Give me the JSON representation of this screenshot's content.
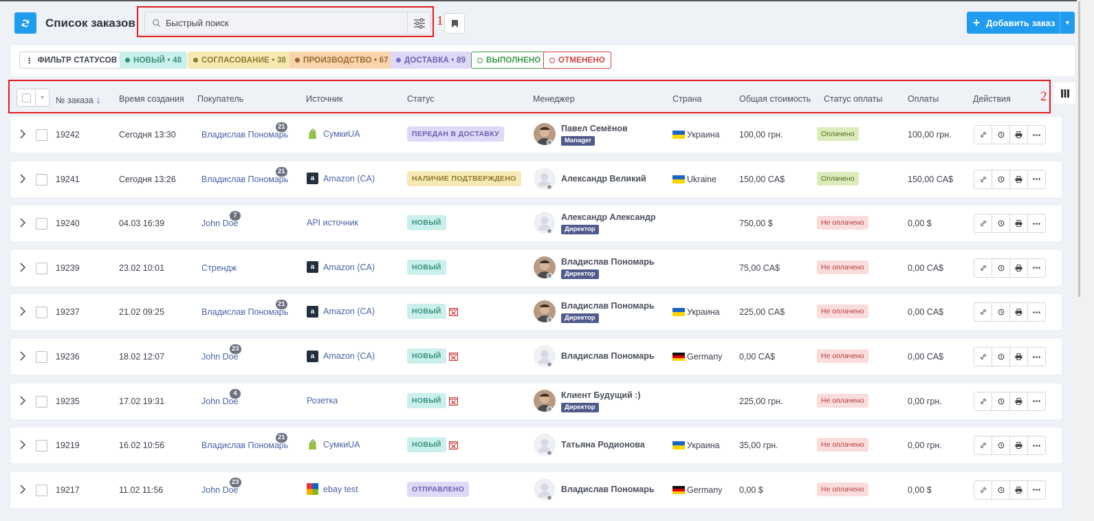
{
  "header": {
    "title": "Список заказов",
    "search_placeholder": "Быстрый поиск",
    "add_button": "Добавить заказ",
    "annotation_1": "1",
    "annotation_2": "2"
  },
  "status_filter": {
    "label": "ФИЛЬТР СТАТУСОВ",
    "chips": [
      {
        "label": "НОВЫЙ • 48",
        "bg": "#c9f0ea",
        "fg": "#3c8f82",
        "dot": "#2f8e7b"
      },
      {
        "label": "СОГЛАСОВАНИЕ • 38",
        "bg": "#f6eab4",
        "fg": "#8d7a2e",
        "dot": "#8d7a2e"
      },
      {
        "label": "ПРОИЗВОДСТВО • 67",
        "bg": "#f8d5ac",
        "fg": "#9b6533",
        "dot": "#9b6533"
      },
      {
        "label": "ДОСТАВКА • 89",
        "bg": "#ddd9f7",
        "fg": "#6b62b3",
        "dot": "#7b6fd1"
      },
      {
        "label": "ВЫПОЛНЕНО",
        "bg": "#fff",
        "fg": "#3b9a48",
        "dot": "#3b9a48",
        "outlined": true
      },
      {
        "label": "ОТМЕНЕНО",
        "bg": "#fff",
        "fg": "#d24040",
        "dot": "#d24040",
        "outlined": true
      }
    ]
  },
  "columns": {
    "order_no": "№ заказа",
    "created": "Время создания",
    "buyer": "Покупатель",
    "source": "Источник",
    "status": "Статус",
    "manager": "Менеджер",
    "country": "Страна",
    "total": "Общая стоимость",
    "payment_status": "Статус оплаты",
    "payments": "Оплаты",
    "actions": "Действия"
  },
  "rows": [
    {
      "id": "19242",
      "created": "Сегодня 13:30",
      "buyer": "Владислав Пономарь",
      "buyer_count": "21",
      "source": "СумкиUA",
      "source_icon": "shopify-icon",
      "status": "ПЕРЕДАН В ДОСТАВКУ",
      "status_style": "delivery",
      "cancel_icon": false,
      "manager": "Павел Семёнов",
      "role": "Manager",
      "avatar": "photo-icon",
      "country": "Украина",
      "flag": "ua",
      "total": "100,00 грн.",
      "pay": "Оплачено",
      "paid": true,
      "payments": "100,00 грн."
    },
    {
      "id": "19241",
      "created": "Сегодня 13:26",
      "buyer": "Владислав Пономарь",
      "buyer_count": "21",
      "source": "Amazon (CA)",
      "source_icon": "amazon-icon",
      "status": "НАЛИЧИЕ ПОДТВЕРЖДЕНО",
      "status_style": "confirmed",
      "cancel_icon": false,
      "manager": "Александр Великий",
      "role": "",
      "avatar": "placeholder",
      "country": "Ukraine",
      "flag": "ua",
      "total": "150,00 CA$",
      "pay": "Оплачено",
      "paid": true,
      "payments": "150,00 CA$"
    },
    {
      "id": "19240",
      "created": "04.03 16:39",
      "buyer": "John Doe",
      "buyer_count": "7",
      "source": "API источник",
      "source_icon": "",
      "status": "НОВЫЙ",
      "status_style": "new",
      "cancel_icon": false,
      "manager": "Александр Александр",
      "role": "Директор",
      "avatar": "placeholder",
      "country": "",
      "flag": "",
      "total": "750,00 $",
      "pay": "Не оплачено",
      "paid": false,
      "payments": "0,00 $"
    },
    {
      "id": "19239",
      "created": "23.02 10:01",
      "buyer": "Стрендж",
      "buyer_count": "",
      "source": "Amazon (CA)",
      "source_icon": "amazon-icon",
      "status": "НОВЫЙ",
      "status_style": "new",
      "cancel_icon": false,
      "manager": "Владислав Пономарь",
      "role": "Директор",
      "avatar": "photo-icon",
      "country": "",
      "flag": "",
      "total": "75,00 CA$",
      "pay": "Не оплачено",
      "paid": false,
      "payments": "0,00 CA$"
    },
    {
      "id": "19237",
      "created": "21.02 09:25",
      "buyer": "Владислав Пономарь",
      "buyer_count": "21",
      "source": "Amazon (CA)",
      "source_icon": "amazon-icon",
      "status": "НОВЫЙ",
      "status_style": "new",
      "cancel_icon": true,
      "manager": "Владислав Пономарь",
      "role": "Директор",
      "avatar": "photo-icon",
      "country": "Украина",
      "flag": "ua",
      "total": "225,00 CA$",
      "pay": "Не оплачено",
      "paid": false,
      "payments": "0,00 CA$"
    },
    {
      "id": "19236",
      "created": "18.02 12:07",
      "buyer": "John Doe",
      "buyer_count": "23",
      "source": "Amazon (CA)",
      "source_icon": "amazon-icon",
      "status": "НОВЫЙ",
      "status_style": "new",
      "cancel_icon": true,
      "manager": "Владислав Пономарь",
      "role": "",
      "avatar": "placeholder",
      "country": "Germany",
      "flag": "de",
      "total": "0,00 CA$",
      "pay": "Не оплачено",
      "paid": false,
      "payments": "0,00 CA$"
    },
    {
      "id": "19235",
      "created": "17.02 19:31",
      "buyer": "John Doe",
      "buyer_count": "4",
      "source": "Розетка",
      "source_icon": "",
      "status": "НОВЫЙ",
      "status_style": "new",
      "cancel_icon": true,
      "manager": "Клиент Будущий :)",
      "role": "Директор",
      "avatar": "photo-icon",
      "country": "",
      "flag": "",
      "total": "225,00 грн.",
      "pay": "Не оплачено",
      "paid": false,
      "payments": "0,00 грн."
    },
    {
      "id": "19219",
      "created": "16.02 10:56",
      "buyer": "Владислав Пономарь",
      "buyer_count": "21",
      "source": "СумкиUA",
      "source_icon": "shopify-icon",
      "status": "НОВЫЙ",
      "status_style": "new",
      "cancel_icon": true,
      "manager": "Татьяна Родионова",
      "role": "",
      "avatar": "placeholder",
      "country": "Украина",
      "flag": "ua",
      "total": "35,00 грн.",
      "pay": "Не оплачено",
      "paid": false,
      "payments": "0,00 грн."
    },
    {
      "id": "19217",
      "created": "11.02 11:56",
      "buyer": "John Doe",
      "buyer_count": "23",
      "source": "ebay test",
      "source_icon": "ebay-icon",
      "status": "ОТПРАВЛЕНО",
      "status_style": "delivery",
      "cancel_icon": false,
      "manager": "Владислав Пономарь",
      "role": "",
      "avatar": "placeholder",
      "country": "Germany",
      "flag": "de",
      "total": "0,00 $",
      "pay": "Не оплачено",
      "paid": false,
      "payments": "0,00 $"
    }
  ]
}
